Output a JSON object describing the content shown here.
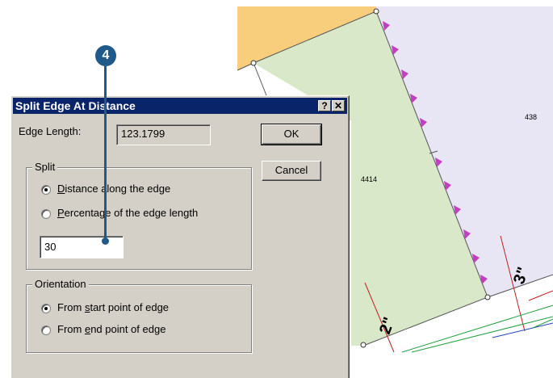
{
  "colors": {
    "title_bar": "#0a246a",
    "dialog_face": "#d4d0c8",
    "callout": "#1f5a8a",
    "parcel_orange": "#f8cd7c",
    "parcel_green": "#d8e8c8",
    "parcel_lavender": "#e8e6f4",
    "edge_arrows": "#c040c0"
  },
  "callout": {
    "step_number": "4"
  },
  "map": {
    "parcel_labels": {
      "center": "4414",
      "right": "438"
    },
    "dimension_labels": {
      "three": "3\"",
      "two": "2\""
    }
  },
  "dialog": {
    "title": "Split Edge At Distance",
    "help_button": "?",
    "close_button": "✕",
    "edge_length_label": "Edge Length:",
    "edge_length_value": "123.1799",
    "ok_button": "OK",
    "cancel_button": "Cancel",
    "split_group": {
      "legend": "Split",
      "options": [
        {
          "mnemonic": "D",
          "rest": "istance along the edge",
          "selected": true
        },
        {
          "mnemonic": "P",
          "rest": "ercentage of the edge length",
          "selected": false
        }
      ],
      "input_value": "30"
    },
    "orientation_group": {
      "legend": "Orientation",
      "options": [
        {
          "before": "From ",
          "mnemonic": "s",
          "after": "tart point of edge",
          "selected": true
        },
        {
          "before": "From ",
          "mnemonic": "e",
          "after": "nd point of edge",
          "selected": false
        }
      ]
    }
  }
}
